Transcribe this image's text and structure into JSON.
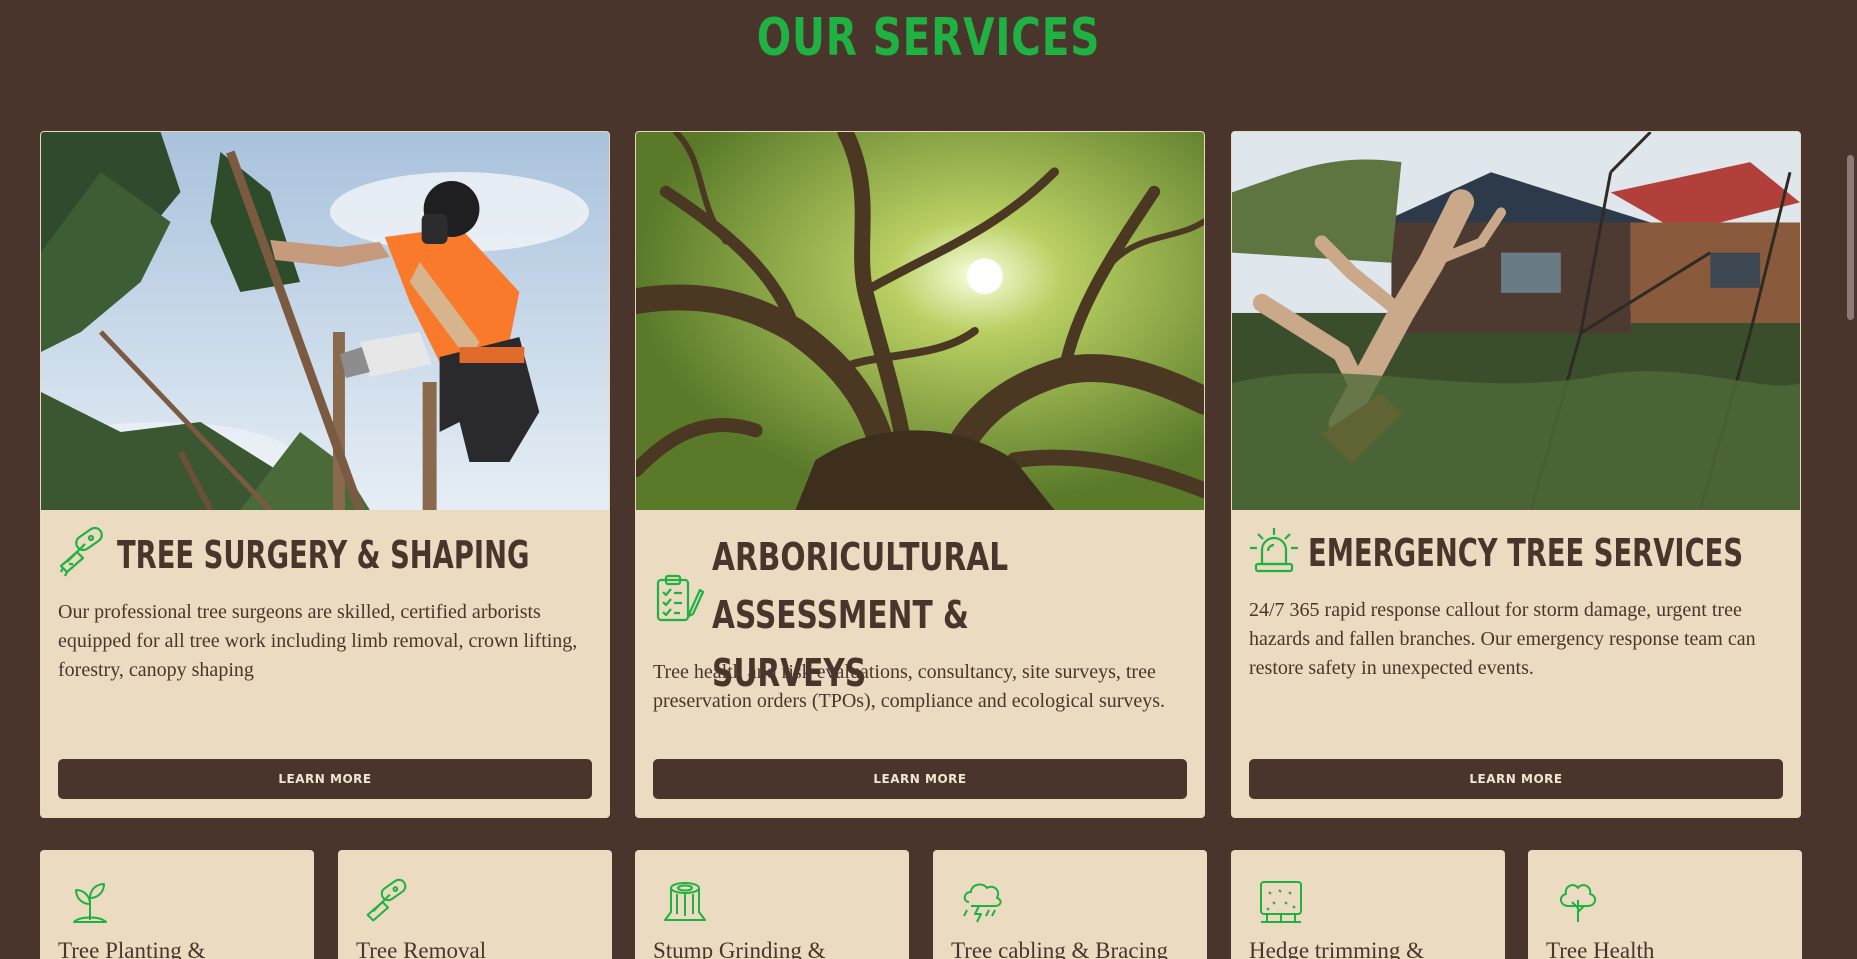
{
  "section": {
    "title": "OUR SERVICES"
  },
  "colors": {
    "background": "#4a352c",
    "card": "#ebdbc0",
    "accent": "#1fb141",
    "text": "#4a352c"
  },
  "cards": [
    {
      "icon": "chainsaw-icon",
      "title": "TREE SURGERY & SHAPING",
      "description": "Our professional tree surgeons are skilled, certified arborists equipped for all tree work including limb removal, crown lifting, forestry, canopy shaping",
      "button": "LEARN MORE",
      "image": "arborist-climbing-tree-photo"
    },
    {
      "icon": "clipboard-checklist-icon",
      "title": "ARBORICULTURAL ASSESSMENT & SURVEYS",
      "description": "Tree health and risk evaluations, consultancy, site surveys, tree preservation orders (TPOs), compliance and ecological surveys.",
      "button": "LEARN MORE",
      "image": "tree-canopy-from-below-photo"
    },
    {
      "icon": "emergency-siren-icon",
      "title": "EMERGENCY TREE SERVICES",
      "description": "24/7 365 rapid response callout for storm damage, urgent tree hazards and fallen branches. Our emergency response team can restore safety in unexpected events.",
      "button": "LEARN MORE",
      "image": "storm-damaged-tree-on-house-photo"
    }
  ],
  "mini_cards": [
    {
      "icon": "sapling-icon",
      "label": "Tree Planting &"
    },
    {
      "icon": "chainsaw-icon",
      "label": "Tree Removal"
    },
    {
      "icon": "tree-stump-icon",
      "label": "Stump Grinding &"
    },
    {
      "icon": "storm-cloud-icon",
      "label": "Tree cabling & Bracing"
    },
    {
      "icon": "hedge-icon",
      "label": "Hedge trimming &"
    },
    {
      "icon": "tree-icon",
      "label": "Tree Health"
    }
  ]
}
